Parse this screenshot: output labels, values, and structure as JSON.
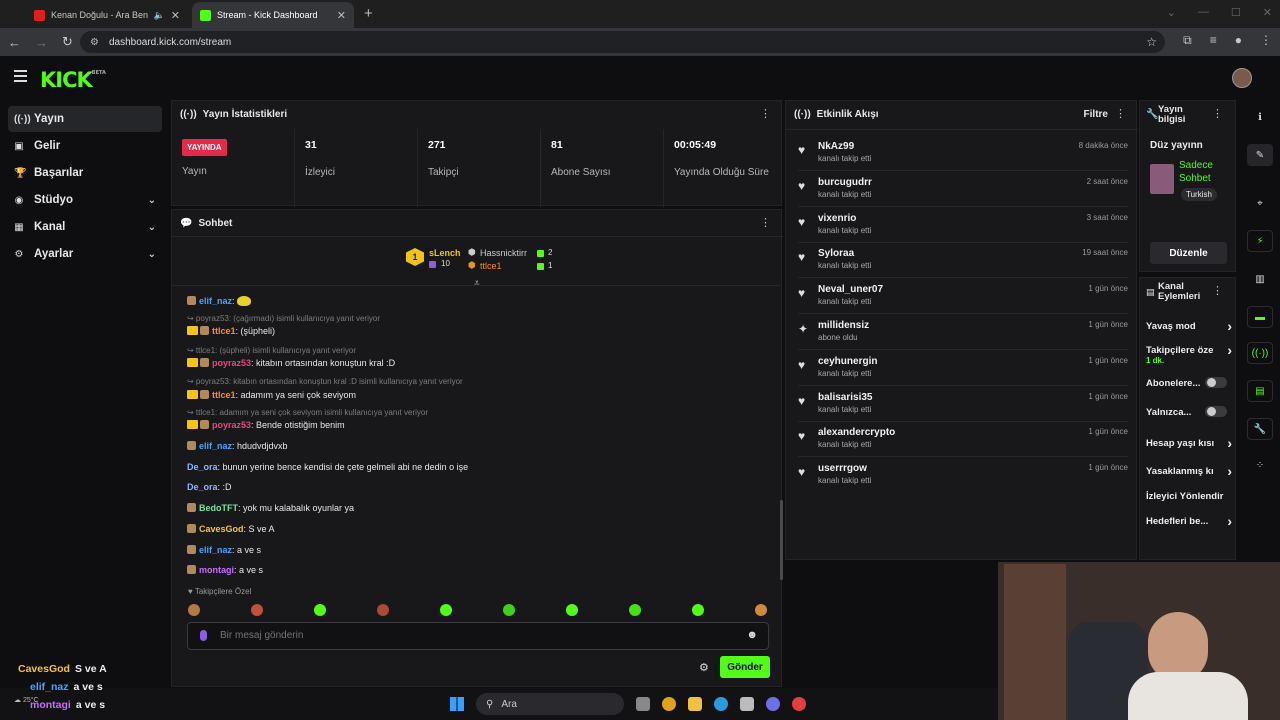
{
  "browser": {
    "tabs": [
      {
        "title": "Kenan Doğulu - Ara Beni Lü",
        "active": false
      },
      {
        "title": "Stream - Kick Dashboard",
        "active": true
      }
    ],
    "new_tab": "+",
    "url": "dashboard.kick.com/stream"
  },
  "brand": {
    "logo": "KICK",
    "beta": "BETA",
    "accent": "#53fc18"
  },
  "sidebar": {
    "items": [
      {
        "label": "Yayın",
        "icon": "broadcast-icon",
        "active": true
      },
      {
        "label": "Gelir",
        "icon": "money-icon"
      },
      {
        "label": "Başarılar",
        "icon": "trophy-icon"
      },
      {
        "label": "Stüdyo",
        "icon": "studio-icon",
        "expandable": true
      },
      {
        "label": "Kanal",
        "icon": "channel-icon",
        "expandable": true
      },
      {
        "label": "Ayarlar",
        "icon": "settings-icon",
        "expandable": true
      }
    ]
  },
  "stats": {
    "title": "Yayın İstatistikleri",
    "live_badge": "YAYINDA",
    "live_label": "Yayın",
    "cells": [
      {
        "value": "31",
        "label": "İzleyici"
      },
      {
        "value": "271",
        "label": "Takipçi"
      },
      {
        "value": "81",
        "label": "Abone Sayısı"
      },
      {
        "value": "00:05:49",
        "label": "Yayında Olduğu Süre"
      }
    ]
  },
  "chat": {
    "title": "Sohbet",
    "top": [
      {
        "rank": "1",
        "name": "sLench",
        "count": "10"
      },
      {
        "name": "Hassnicktirr",
        "count": "2"
      },
      {
        "name": "ttlce1",
        "count": "1"
      }
    ],
    "messages": [
      {
        "kind": "msg",
        "user": "elif_naz",
        "color": "#4aa3ff",
        "text": ": ",
        "crown": false
      },
      {
        "kind": "reply",
        "text": "poyraz53: (çağırmadı) isimli kullanıcıya yanıt veriyor"
      },
      {
        "kind": "msg",
        "user": "ttlce1",
        "color": "#ff8c1a",
        "text": ": (şüpheli)",
        "crown": true
      },
      {
        "kind": "reply",
        "text": "ttlce1: (şüpheli) isimli kullanıcıya yanıt veriyor"
      },
      {
        "kind": "msg",
        "user": "poyraz53",
        "color": "#e0487a",
        "text": ": kitabın ortasından konuştun kral :D",
        "crown": true
      },
      {
        "kind": "reply",
        "text": "poyraz53: kitabın ortasından konuştun kral :D isimli kullanıcıya yanıt veriyor"
      },
      {
        "kind": "msg",
        "user": "ttlce1",
        "color": "#ff8c1a",
        "text": ": adamım ya seni çok seviyom",
        "crown": true
      },
      {
        "kind": "reply",
        "text": "ttlce1: adamım ya seni çok seviyom isimli kullanıcıya yanıt veriyor"
      },
      {
        "kind": "msg",
        "user": "poyraz53",
        "color": "#e0487a",
        "text": ": Bende otistiğim benim",
        "crown": true
      },
      {
        "kind": "msg",
        "user": "elif_naz",
        "color": "#4aa3ff",
        "text": ": hdudvdjdvxb",
        "crown": false
      },
      {
        "kind": "msg",
        "user": "De_ora",
        "color": "#8fb5ff",
        "text": ": bunun yerine bence kendisi de çete gelmeli abi ne dedin o işe",
        "crown": false,
        "nobadge": true
      },
      {
        "kind": "msg",
        "user": "De_ora",
        "color": "#8fb5ff",
        "text": ": :D",
        "crown": false,
        "nobadge": true
      },
      {
        "kind": "msg",
        "user": "BedoTFT",
        "color": "#7ee0a8",
        "text": ": yok mu kalabalık oyunlar ya",
        "crown": false
      },
      {
        "kind": "msg",
        "user": "CavesGod",
        "color": "#f5c242",
        "text": ": S ve A",
        "crown": false
      },
      {
        "kind": "msg",
        "user": "elif_naz",
        "color": "#4aa3ff",
        "text": ": a ve s",
        "crown": false
      },
      {
        "kind": "msg",
        "user": "montagi",
        "color": "#c86bff",
        "text": ": a ve s",
        "crown": false
      }
    ],
    "followers_only": "Takipçilere Özel",
    "input_placeholder": "Bir mesaj gönderin",
    "send_label": "Gönder"
  },
  "activity": {
    "title": "Etkinlik Akışı",
    "filter": "Filtre",
    "events": [
      {
        "name": "NkAz99",
        "desc": "kanalı takip etti",
        "time": "8 dakika önce"
      },
      {
        "name": "burcugudrr",
        "desc": "kanalı takip etti",
        "time": "2 saat önce"
      },
      {
        "name": "vixenrio",
        "desc": "kanalı takip etti",
        "time": "3 saat önce"
      },
      {
        "name": "Syloraa",
        "desc": "kanalı takip etti",
        "time": "19 saat önce"
      },
      {
        "name": "Neval_uner07",
        "desc": "kanalı takip etti",
        "time": "1 gün önce"
      },
      {
        "name": "millidensiz",
        "desc": "abone oldu",
        "time": "1 gün önce",
        "sub": true
      },
      {
        "name": "ceyhunergin",
        "desc": "kanalı takip etti",
        "time": "1 gün önce"
      },
      {
        "name": "balisarisi35",
        "desc": "kanalı takip etti",
        "time": "1 gün önce"
      },
      {
        "name": "alexandercrypto",
        "desc": "kanalı takip etti",
        "time": "1 gün önce"
      },
      {
        "name": "userrrgow",
        "desc": "kanalı takip etti",
        "time": "1 gün önce"
      }
    ]
  },
  "stream_info": {
    "title_line1": "Yayın",
    "title_line2": "bilgisi",
    "stream_title": "Düz yayınn",
    "category_line1": "Sadece",
    "category_line2": "Sohbet",
    "language": "Turkish",
    "edit_label": "Düzenle"
  },
  "channel_actions": {
    "title_line1": "Kanal",
    "title_line2": "Eylemleri",
    "items": [
      {
        "label": "Yavaş mod",
        "type": "chevron"
      },
      {
        "label": "Takipçilere öze",
        "sub": "1 dk.",
        "type": "chevron"
      },
      {
        "label": "Abonelere...",
        "type": "toggle"
      },
      {
        "label": "Yalnızca...",
        "type": "toggle"
      },
      {
        "label": "Hesap yaşı kısı",
        "type": "chevron"
      },
      {
        "label": "Yasaklanmış kı",
        "type": "chevron"
      },
      {
        "label": "İzleyici Yönlendir",
        "type": "none"
      },
      {
        "label": "Hedefleri be...",
        "type": "chevron"
      }
    ]
  },
  "overlay_chat": [
    {
      "user": "CavesGod",
      "color": "#f5c242",
      "text": "S ve A"
    },
    {
      "user": "elif_naz",
      "color": "#4aa3ff",
      "text": "a ve s"
    },
    {
      "user": "montagi",
      "color": "#c86bff",
      "text": "a ve s"
    }
  ],
  "taskbar": {
    "search": "Ara",
    "temp": "25°C"
  }
}
